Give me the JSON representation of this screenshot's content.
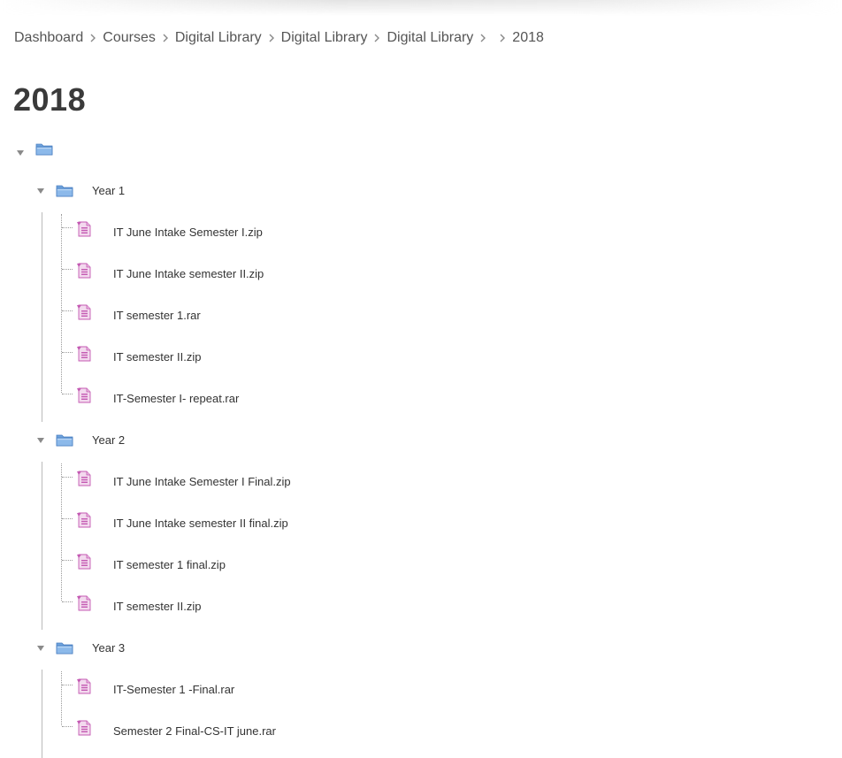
{
  "breadcrumb": {
    "items": [
      "Dashboard",
      "Courses",
      "Digital Library",
      "Digital Library",
      "Digital Library",
      "",
      "2018"
    ]
  },
  "page": {
    "title": "2018"
  },
  "tree": {
    "root_label": "",
    "folders": [
      {
        "label": "Year 1",
        "files": [
          "IT June Intake Semester I.zip",
          "IT June Intake semester II.zip",
          "IT semester 1.rar",
          "IT semester II.zip",
          "IT-Semester I- repeat.rar"
        ]
      },
      {
        "label": "Year 2",
        "files": [
          "IT June Intake Semester I Final.zip",
          "IT June Intake semester II final.zip",
          "IT semester 1 final.zip",
          "IT semester II.zip"
        ]
      },
      {
        "label": "Year 3",
        "files": [
          "IT-Semester 1 -Final.rar",
          "Semester 2 Final-CS-IT june.rar"
        ]
      }
    ]
  },
  "colors": {
    "folder_blue": "#6fa3dd",
    "archive_pink": "#c45ab3",
    "text": "#333333"
  }
}
